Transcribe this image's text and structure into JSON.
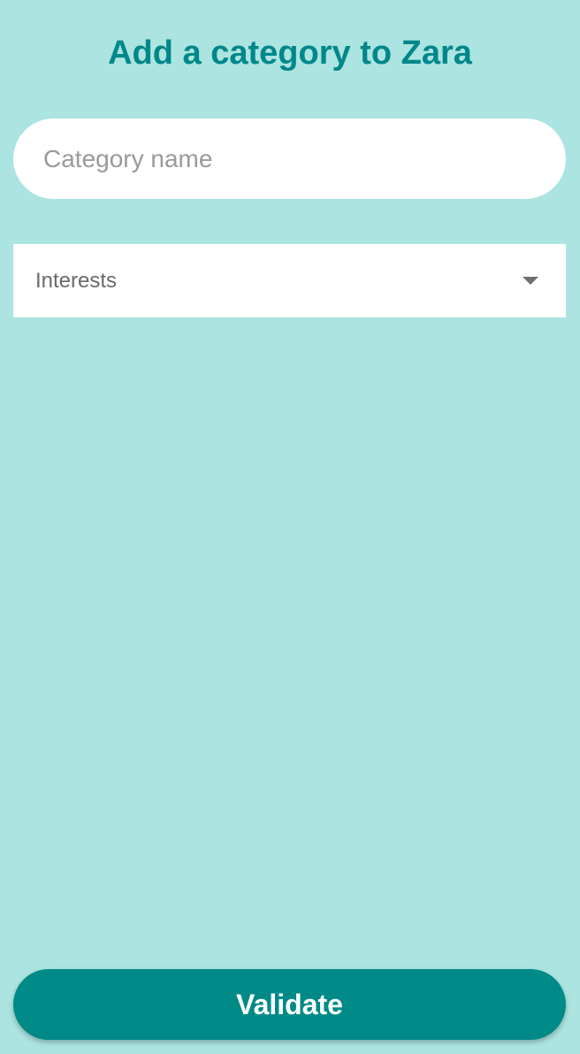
{
  "header": {
    "title": "Add a category to Zara"
  },
  "form": {
    "name_placeholder": "Category name",
    "name_value": "",
    "dropdown_selected": "Interests",
    "validate_label": "Validate"
  },
  "colors": {
    "background": "#ABE4E0",
    "accent": "#00878A",
    "button": "#008A87"
  }
}
